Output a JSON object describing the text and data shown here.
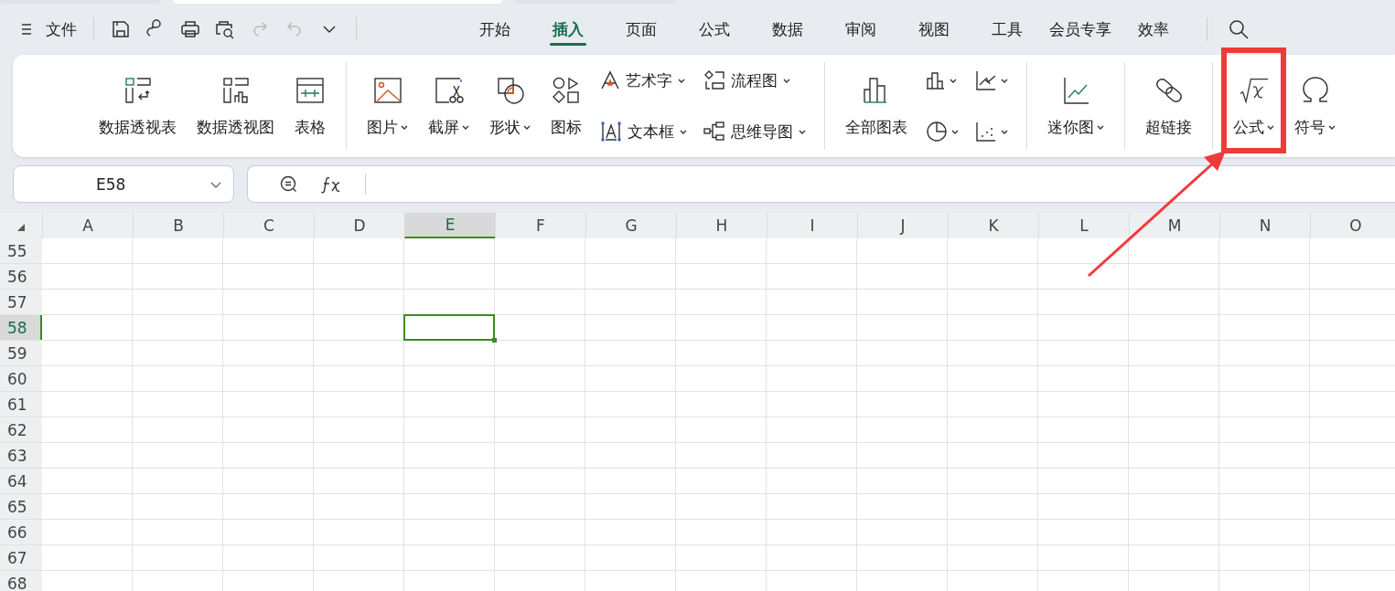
{
  "menu": {
    "label": "文件"
  },
  "tabs": [
    {
      "label": "开始",
      "selected": false
    },
    {
      "label": "插入",
      "selected": true
    },
    {
      "label": "页面",
      "selected": false
    },
    {
      "label": "公式",
      "selected": false
    },
    {
      "label": "数据",
      "selected": false
    },
    {
      "label": "审阅",
      "selected": false
    },
    {
      "label": "视图",
      "selected": false
    },
    {
      "label": "工具",
      "selected": false
    },
    {
      "label": "会员专享",
      "selected": false
    },
    {
      "label": "效率",
      "selected": false
    }
  ],
  "ribbon": [
    {
      "items": [
        {
          "kind": "large",
          "label": "数据透视表",
          "dropdown": false,
          "highlighted": false
        },
        {
          "kind": "large",
          "label": "数据透视图",
          "dropdown": false,
          "highlighted": false
        },
        {
          "kind": "large",
          "label": "表格",
          "dropdown": false,
          "highlighted": false
        }
      ]
    },
    {
      "items": [
        {
          "kind": "large",
          "label": "图片",
          "dropdown": true,
          "highlighted": false
        },
        {
          "kind": "large",
          "label": "截屏",
          "dropdown": true,
          "highlighted": false
        },
        {
          "kind": "large",
          "label": "形状",
          "dropdown": true,
          "highlighted": false
        },
        {
          "kind": "large",
          "label": "图标",
          "dropdown": false,
          "highlighted": false
        },
        {
          "kind": "small",
          "label": "艺术字",
          "dropdown": true
        },
        {
          "kind": "small",
          "label": "文本框",
          "dropdown": true
        },
        {
          "kind": "small",
          "label": "流程图",
          "dropdown": true
        },
        {
          "kind": "small",
          "label": "思维导图",
          "dropdown": true
        }
      ]
    },
    {
      "items": [
        {
          "kind": "large",
          "label": "全部图表",
          "dropdown": false,
          "highlighted": false
        },
        {
          "kind": "icon",
          "dropdown": true
        },
        {
          "kind": "icon",
          "dropdown": true
        },
        {
          "kind": "icon",
          "dropdown": true
        },
        {
          "kind": "icon",
          "dropdown": true
        }
      ]
    },
    {
      "items": [
        {
          "kind": "large",
          "label": "迷你图",
          "dropdown": true,
          "highlighted": false
        }
      ]
    },
    {
      "items": [
        {
          "kind": "large",
          "label": "超链接",
          "dropdown": false,
          "highlighted": false
        }
      ]
    },
    {
      "items": [
        {
          "kind": "large",
          "label": "公式",
          "dropdown": true,
          "highlighted": true
        },
        {
          "kind": "large",
          "label": "符号",
          "dropdown": true,
          "highlighted": false
        }
      ]
    }
  ],
  "name_box": {
    "value": "E58"
  },
  "columns": [
    {
      "label": "A",
      "selected": false
    },
    {
      "label": "B",
      "selected": false
    },
    {
      "label": "C",
      "selected": false
    },
    {
      "label": "D",
      "selected": false
    },
    {
      "label": "E",
      "selected": true
    },
    {
      "label": "F",
      "selected": false
    },
    {
      "label": "G",
      "selected": false
    },
    {
      "label": "H",
      "selected": false
    },
    {
      "label": "I",
      "selected": false
    },
    {
      "label": "J",
      "selected": false
    },
    {
      "label": "K",
      "selected": false
    },
    {
      "label": "L",
      "selected": false
    },
    {
      "label": "M",
      "selected": false
    },
    {
      "label": "N",
      "selected": false
    },
    {
      "label": "O",
      "selected": false
    }
  ],
  "rows": [
    {
      "label": "55",
      "selected": false
    },
    {
      "label": "56",
      "selected": false
    },
    {
      "label": "57",
      "selected": false
    },
    {
      "label": "58",
      "selected": true
    },
    {
      "label": "59",
      "selected": false
    },
    {
      "label": "60",
      "selected": false
    },
    {
      "label": "61",
      "selected": false
    },
    {
      "label": "62",
      "selected": false
    },
    {
      "label": "63",
      "selected": false
    },
    {
      "label": "64",
      "selected": false
    },
    {
      "label": "65",
      "selected": false
    },
    {
      "label": "66",
      "selected": false
    },
    {
      "label": "67",
      "selected": false
    },
    {
      "label": "68",
      "selected": false
    }
  ]
}
